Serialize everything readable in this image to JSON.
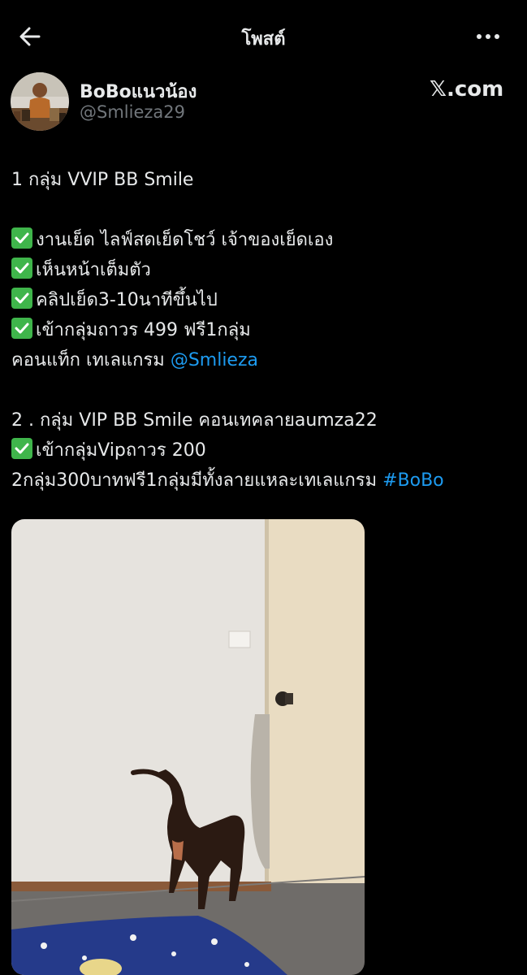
{
  "header": {
    "title": "โพสต์",
    "back_icon": "arrow-left-icon",
    "more_icon": "more-horizontal-icon"
  },
  "author": {
    "name": "BoBoแนวน้อง",
    "handle": "@Smlieza29",
    "brand": "𝕏.com"
  },
  "post": {
    "l1": "1 กลุ่ม VVIP BB Smile",
    "l2": "งานเย็ด ไลฟ์สดเย็ดโชว์ เจ้าของเย็ดเอง",
    "l3": "เห็นหน้าเต็มตัว",
    "l4": "คลิปเย็ด3-10นาทีขึ้นไป",
    "l5": "เข้ากลุ่มถาวร 499 ฟรี1กลุ่ม",
    "l6_text": "คอนแท็ก เทเลแกรม ",
    "l6_link": "@Smlieza",
    "l7": "2 . กลุ่ม VIP BB Smile คอนเทคลายaumza22",
    "l8": "เข้ากลุ่มVipถาวร 200",
    "l9_text": "2กลุ่ม300บาทฟรี1กลุ่มมีทั้งลายแหละเทเลแกรม ",
    "l9_link": "#BoBo"
  },
  "colors": {
    "background": "#000000",
    "text": "#e7e9ea",
    "secondary": "#71767b",
    "link": "#1d9bf0",
    "check": "#3fb54b"
  },
  "media": {
    "type": "video-still"
  }
}
